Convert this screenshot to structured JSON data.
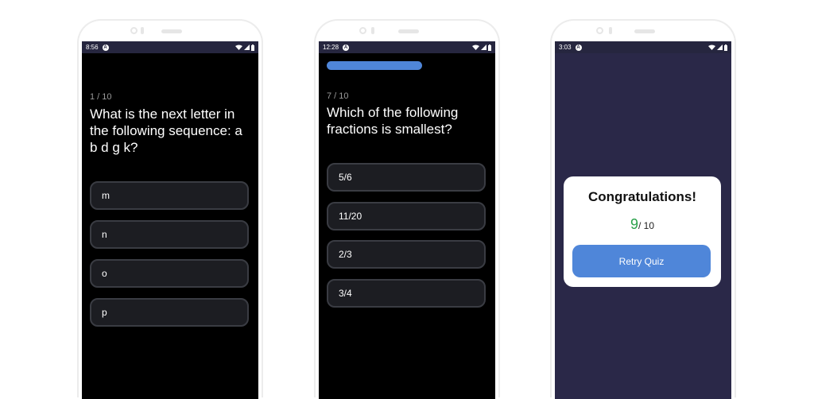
{
  "screens": [
    {
      "status_time": "8:56",
      "counter_current": "1",
      "counter_total": "10",
      "question": "What is the next letter in the following sequence: a b d g k?",
      "options": [
        "m",
        "n",
        "o",
        "p"
      ]
    },
    {
      "status_time": "12:28",
      "progress": 0.7,
      "counter_current": "7",
      "counter_total": "10",
      "question": "Which of the following fractions is smallest?",
      "options": [
        "5/6",
        "11/20",
        "2/3",
        "3/4"
      ]
    },
    {
      "status_time": "3:03",
      "dialog": {
        "title": "Congratulations!",
        "score": "9",
        "score_total": "10",
        "retry_label": "Retry Quiz"
      }
    }
  ],
  "colors": {
    "status_bar": "#26263f",
    "quiz_background": "#000000",
    "result_background": "#2a2848",
    "accent": "#4f86d9",
    "score_green": "#2aa14a"
  },
  "icons": [
    "app-badge-icon",
    "wifi-icon",
    "signal-icon",
    "battery-icon"
  ]
}
